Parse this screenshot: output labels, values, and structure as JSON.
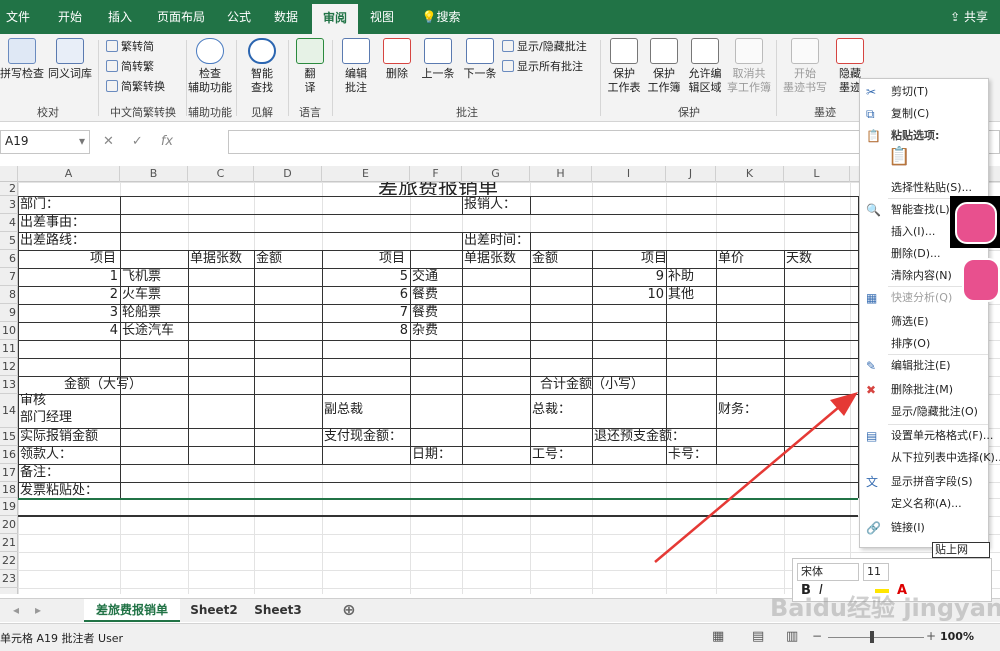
{
  "ribbon_tabs": [
    "文件",
    "开始",
    "插入",
    "页面布局",
    "公式",
    "数据",
    "审阅",
    "视图",
    "搜索"
  ],
  "share": "共享",
  "groups": {
    "proof": {
      "label": "校对",
      "btn1": "拼写检查",
      "btn2": "同义词库"
    },
    "chinese": {
      "label": "中文简繁转换",
      "b1": "繁转简",
      "b2": "简转繁",
      "b3": "简繁转换"
    },
    "access": {
      "label": "辅助功能",
      "btn": "检查\n辅助功能"
    },
    "insights": {
      "label": "见解",
      "btn": "智能\n查找"
    },
    "lang": {
      "label": "语言",
      "btn": "翻\n译"
    },
    "comments": {
      "label": "批注",
      "edit": "编辑\n批注",
      "delete": "删除",
      "prev": "上一条",
      "next": "下一条",
      "showhide": "显示/隐藏批注",
      "showall": "显示所有批注"
    },
    "protect": {
      "label": "保护",
      "sheet": "保护\n工作表",
      "book": "保护\n工作簿",
      "ranges": "允许编\n辑区域",
      "share": "取消共\n享工作簿"
    },
    "ink": {
      "label": "墨迹",
      "start": "开始\n墨迹书写",
      "hide": "隐藏\n墨迹"
    }
  },
  "namebox": "A19",
  "fx_label": "fx",
  "columns": [
    "A",
    "B",
    "C",
    "D",
    "E",
    "F",
    "G",
    "H",
    "I",
    "J",
    "K",
    "L"
  ],
  "rows": [
    "2",
    "3",
    "4",
    "5",
    "6",
    "7",
    "8",
    "9",
    "10",
    "11",
    "12",
    "13",
    "14",
    "15",
    "16",
    "17",
    "18",
    "19",
    "20",
    "21",
    "22",
    "23"
  ],
  "sheet": {
    "title": "差旅费报销单",
    "dept": "部门：",
    "reason": "出差事由：",
    "route": "出差路线：",
    "reporter": "报销人：",
    "time": "出差时间：",
    "h_item": "项目",
    "h_count": "单据张数",
    "h_amount": "金额",
    "h_price": "单价",
    "h_days": "天数",
    "items": [
      {
        "n": "1",
        "name": "飞机票"
      },
      {
        "n": "2",
        "name": "火车票"
      },
      {
        "n": "3",
        "name": "轮船票"
      },
      {
        "n": "4",
        "name": "长途汽车"
      },
      {
        "n": "5",
        "name": "交通"
      },
      {
        "n": "6",
        "name": "餐费"
      },
      {
        "n": "7",
        "name": "餐费"
      },
      {
        "n": "8",
        "name": "杂费"
      },
      {
        "n": "9",
        "name": "补助"
      },
      {
        "n": "10",
        "name": "其他"
      }
    ],
    "amt_upper": "金额（大写）",
    "total_lower": "合计金额（小写）",
    "audit": "审核",
    "dept_mgr": "部门经理",
    "vp": "副总裁",
    "ceo": "总裁：",
    "finance": "财务：",
    "actual": "实际报销金额",
    "cash": "支付现金额：",
    "refund": "退还预支金额：",
    "payee": "领款人：",
    "date": "日期：",
    "empno": "工号：",
    "card": "卡号：",
    "remark": "备注：",
    "invoice": "发票粘贴处："
  },
  "sheet_tabs": [
    "差旅费报销单",
    "Sheet2",
    "Sheet3"
  ],
  "status_text": "单元格 A19 批注者 User",
  "zoom": "100%",
  "context_menu": [
    {
      "label": "剪切(T)",
      "icon": "scissors-icon"
    },
    {
      "label": "复制(C)",
      "icon": "copy-icon"
    },
    {
      "label": "粘贴选项:",
      "icon": "paste-icon",
      "header": true
    },
    {
      "label": "",
      "icon": "paste-option-icon"
    },
    {
      "label": "选择性粘贴(S)...",
      "icon": ""
    },
    {
      "label": "智能查找(L)",
      "icon": "smart-lookup-icon"
    },
    {
      "label": "插入(I)...",
      "icon": ""
    },
    {
      "label": "删除(D)...",
      "icon": ""
    },
    {
      "label": "清除内容(N)",
      "icon": ""
    },
    {
      "label": "快速分析(Q)",
      "icon": "quick-analysis-icon",
      "disabled": true
    },
    {
      "label": "筛选(E)",
      "icon": ""
    },
    {
      "label": "排序(O)",
      "icon": ""
    },
    {
      "label": "编辑批注(E)",
      "icon": "edit-comment-icon"
    },
    {
      "label": "删除批注(M)",
      "icon": "delete-comment-icon"
    },
    {
      "label": "显示/隐藏批注(O)",
      "icon": ""
    },
    {
      "label": "设置单元格格式(F)...",
      "icon": "format-cells-icon"
    },
    {
      "label": "从下拉列表中选择(K)...",
      "icon": ""
    },
    {
      "label": "显示拼音字段(S)",
      "icon": "phonetic-icon"
    },
    {
      "label": "定义名称(A)...",
      "icon": ""
    },
    {
      "label": "链接(I)",
      "icon": "link-icon"
    }
  ],
  "mini_toolbar": {
    "font": "宋体",
    "size": "11"
  },
  "partial_cell_text": "贴上网",
  "watermark": "Baidu经验 jingyan.baidu.com",
  "colors": {
    "excel_green": "#217346",
    "arrow_red": "#e53935",
    "pink": "#e8508e"
  }
}
